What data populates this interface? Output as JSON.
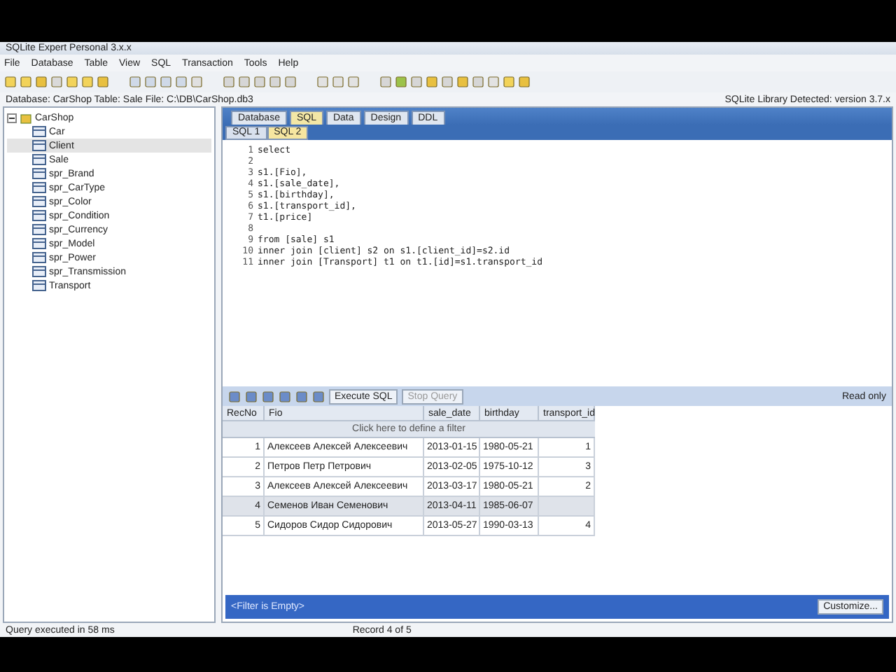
{
  "window": {
    "title": "SQLite Expert Personal 3.x.x"
  },
  "menu": [
    "File",
    "Database",
    "Table",
    "View",
    "SQL",
    "Transaction",
    "Tools",
    "Help"
  ],
  "info": {
    "left": "Database: CarShop   Table: Sale   File: C:\\DB\\CarShop.db3",
    "right": "SQLite Library Detected: version 3.7.x"
  },
  "tree": {
    "label": "CarShop",
    "expanded": true,
    "children": [
      {
        "label": "Car",
        "selected": false
      },
      {
        "label": "Client",
        "selected": true
      },
      {
        "label": "Sale",
        "selected": false
      },
      {
        "label": "spr_Brand",
        "selected": false
      },
      {
        "label": "spr_CarType",
        "selected": false
      },
      {
        "label": "spr_Color",
        "selected": false
      },
      {
        "label": "spr_Condition",
        "selected": false
      },
      {
        "label": "spr_Currency",
        "selected": false
      },
      {
        "label": "spr_Model",
        "selected": false
      },
      {
        "label": "spr_Power",
        "selected": false
      },
      {
        "label": "spr_Transmission",
        "selected": false
      },
      {
        "label": "Transport",
        "selected": false
      }
    ]
  },
  "tabs": [
    {
      "label": "Database",
      "selected": false
    },
    {
      "label": "SQL",
      "selected": true
    },
    {
      "label": "Data",
      "selected": false
    },
    {
      "label": "Design",
      "selected": false
    },
    {
      "label": "DDL",
      "selected": false
    }
  ],
  "sql_tabs": [
    {
      "label": "SQL 1",
      "selected": false
    },
    {
      "label": "SQL 2",
      "selected": true
    }
  ],
  "editor": {
    "lines": [
      {
        "number": "1",
        "text": "select"
      },
      {
        "number": "2"
      },
      {
        "number": "3",
        "text": "s1.[Fio],"
      },
      {
        "number": "4",
        "text": "s1.[sale_date],"
      },
      {
        "number": "5",
        "text": "s1.[birthday],"
      },
      {
        "number": "6",
        "text": "s1.[transport_id],"
      },
      {
        "number": "7",
        "text": "t1.[price]"
      },
      {
        "number": "8"
      },
      {
        "number": "9",
        "text": "from [sale] s1"
      },
      {
        "number": "10",
        "text": "inner join [client] s2 on s1.[client_id]=s2.id"
      },
      {
        "number": "11",
        "text": "inner join [Transport] t1 on t1.[id]=s1.transport_id"
      }
    ]
  },
  "grid_toolbar": {
    "execute": "Execute SQL",
    "stop": "Stop Query",
    "mode": "Read only"
  },
  "table": {
    "columns": [
      "RecNo",
      "Fio",
      "sale_date",
      "birthday",
      "transport_id"
    ],
    "filter_hint": "Click here to define a filter",
    "rows": [
      {
        "cells": [
          "1",
          "Алексеев Алексей Алексеевич",
          "2013-01-15",
          "1980-05-21",
          "1"
        ],
        "selected": false
      },
      {
        "cells": [
          "2",
          "Петров Петр Петрович",
          "2013-02-05",
          "1975-10-12",
          "3"
        ],
        "selected": false
      },
      {
        "cells": [
          "3",
          "Алексеев Алексей Алексеевич",
          "2013-03-17",
          "1980-05-21",
          "2"
        ],
        "selected": false
      },
      {
        "cells": [
          "4",
          "Семенов Иван Семенович",
          "2013-04-11",
          "1985-06-07",
          ""
        ],
        "selected": true
      },
      {
        "cells": [
          "5",
          "Сидоров Сидор Сидорович",
          "2013-05-27",
          "1990-03-13",
          "4"
        ],
        "selected": false
      }
    ]
  },
  "filter_bar": {
    "text": "<Filter is Empty>",
    "button": "Customize..."
  },
  "status_bar": {
    "left": "Query executed in 58 ms",
    "middle": "Record 4 of 5"
  }
}
